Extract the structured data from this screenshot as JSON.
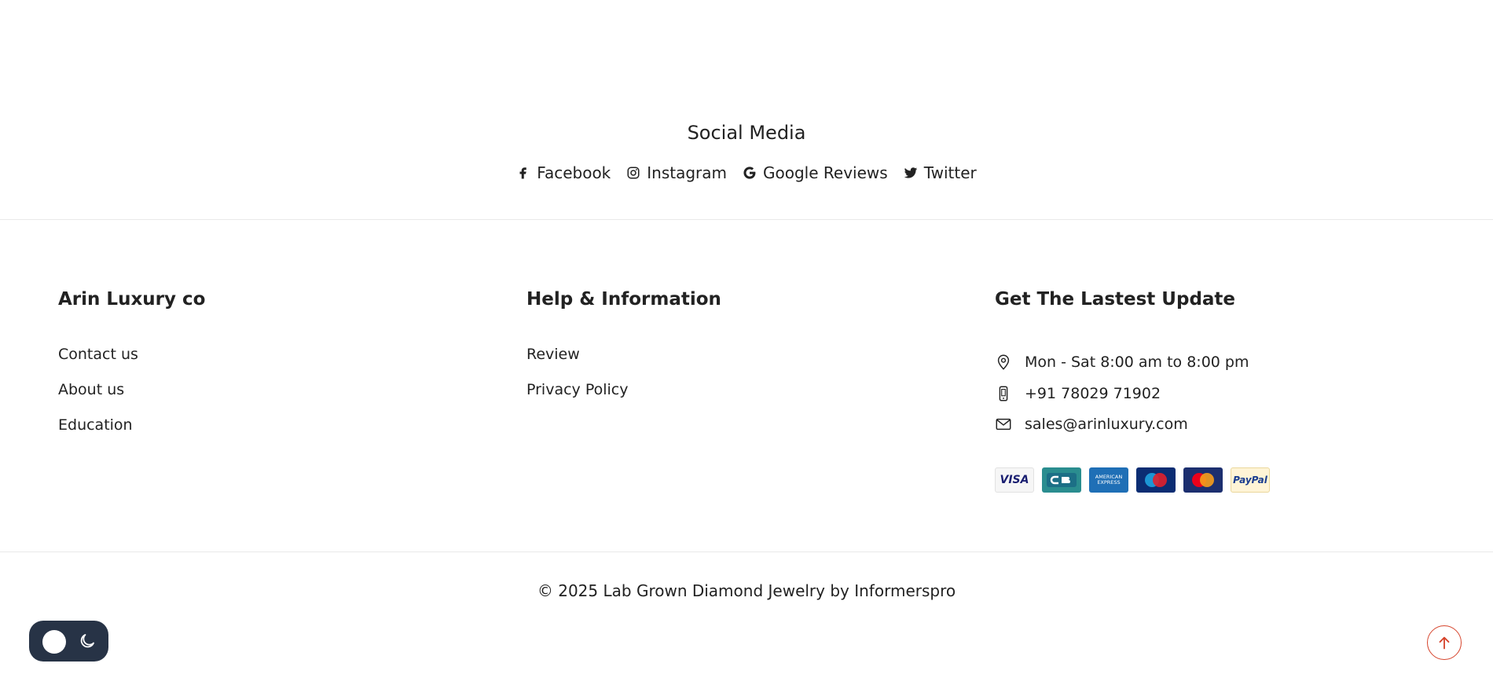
{
  "social": {
    "title": "Social Media",
    "links": [
      {
        "label": "Facebook",
        "icon": "facebook-icon"
      },
      {
        "label": "Instagram",
        "icon": "instagram-icon"
      },
      {
        "label": "Google Reviews",
        "icon": "google-icon"
      },
      {
        "label": "Twitter",
        "icon": "twitter-icon"
      }
    ]
  },
  "footer": {
    "col1": {
      "title": "Arin Luxury co",
      "links": [
        "Contact us",
        "About us",
        "Education"
      ]
    },
    "col2": {
      "title": "Help & Information",
      "links": [
        "Review",
        "Privacy Policy"
      ]
    },
    "col3": {
      "title": "Get The Lastest Update",
      "hours": "Mon - Sat 8:00 am to 8:00 pm",
      "phone": "+91 78029 71902",
      "email": "sales@arinluxury.com",
      "payments": {
        "visa": "VISA",
        "amex_line1": "AMERICAN",
        "amex_line2": "EXPRESS",
        "paypal": "PayPal",
        "icons": [
          "visa-icon",
          "cb-icon",
          "amex-icon",
          "maestro-icon",
          "mastercard-icon",
          "paypal-icon"
        ]
      }
    }
  },
  "copyright": "© 2025 Lab Grown Diamond Jewelry by Informerspro",
  "colors": {
    "accent": "#d6442c",
    "toggle_bg": "#273346",
    "divider": "#e9e9e9",
    "text": "#222222"
  }
}
